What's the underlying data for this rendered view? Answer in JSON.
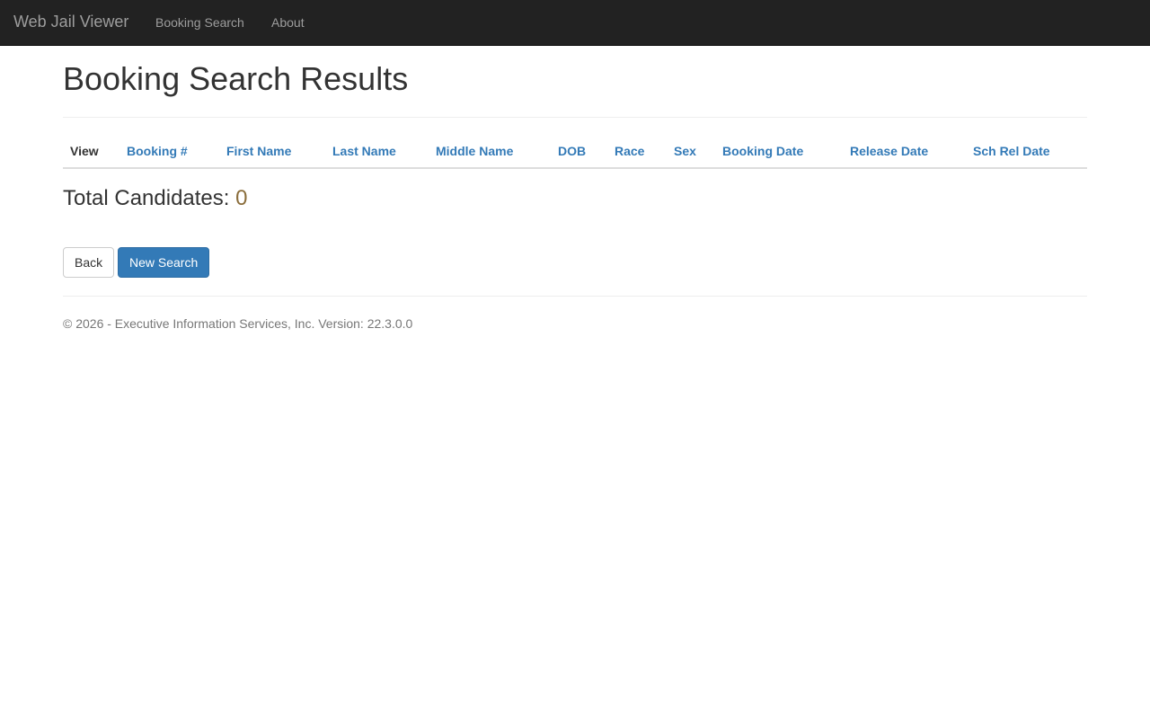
{
  "navbar": {
    "brand": "Web Jail Viewer",
    "links": [
      "Booking Search",
      "About"
    ],
    "background": "#222222"
  },
  "page": {
    "title": "Booking Search Results"
  },
  "table": {
    "columns": [
      "View",
      "Booking #",
      "First Name",
      "Last Name",
      "Middle Name",
      "DOB",
      "Race",
      "Sex",
      "Booking Date",
      "Release Date",
      "Sch Rel Date"
    ],
    "rows": []
  },
  "summary": {
    "label": "Total Candidates:",
    "count": "0"
  },
  "buttons": {
    "back": "Back",
    "new_search": "New Search"
  },
  "footer": {
    "text": "© 2026 - Executive Information Services, Inc. Version: 22.3.0.0"
  },
  "colors": {
    "link": "#337ab7",
    "primary": "#337ab7",
    "count": "#8a6d3b"
  }
}
